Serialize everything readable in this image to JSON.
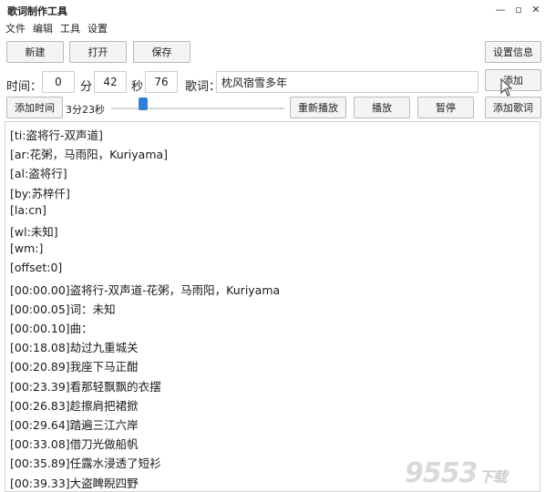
{
  "window": {
    "title": "歌词制作工具",
    "controls": [
      "—",
      "▫",
      "✕"
    ]
  },
  "menu": [
    "文件",
    "编辑",
    "工具",
    "设置"
  ],
  "toolbar": {
    "new_label": "新建",
    "open_label": "打开",
    "save_label": "保存",
    "settings_label": "设置信息"
  },
  "time_row": {
    "time_label": "时间：",
    "minutes_value": "0",
    "min_label": "分",
    "seconds_value": "42",
    "sec_label": "秒",
    "hundredths_value": "76",
    "lyric_label": "歌词：",
    "lyric_value": "枕风宿雪多年",
    "add_label": "添加"
  },
  "controls_row": {
    "add_time_label": "添加时间",
    "duration": "3分23秒",
    "replay_label": "重新播放",
    "play_label": "播放",
    "pause_label": "暂停",
    "add_lyric_label": "添加歌词"
  },
  "playback": {
    "progress_fraction": 0.16
  },
  "lyrics": [
    "[ti:盗将行-双声道]",
    "[ar:花粥，马雨阳，Kuriyama]",
    "[al:盗将行]",
    "[by:苏梓仟]",
    "[la:cn]",
    "[wl:未知]",
    "[wm:]",
    "[offset:0]",
    "[00:00.00]盗将行-双声道-花粥，马雨阳，Kuriyama",
    "[00:00.05]词：未知",
    "[00:00.10]曲：",
    "[00:18.08]劫过九重城关",
    "[00:20.89]我座下马正酣",
    "[00:23.39]看那轻飘飘的衣摆",
    "[00:26.83]趁擦肩把裙掀",
    "[00:29.64]踏遍三江六岸",
    "[00:33.08]借刀光做船帆",
    "[00:35.89]任露水浸透了短衫",
    "[00:39.33]大盗睥睨四野"
  ],
  "watermark": {
    "main": "9553",
    "sub": "下载"
  }
}
